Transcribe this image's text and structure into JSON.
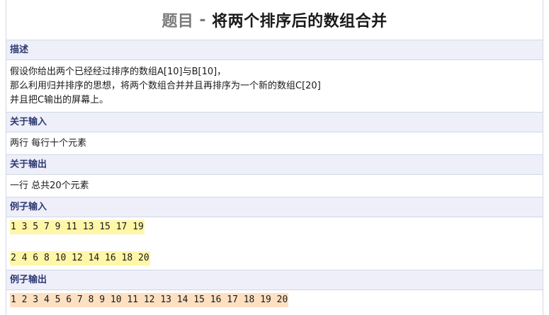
{
  "title": {
    "prefix": "题目",
    "separator": "-",
    "main": "将两个排序后的数组合并"
  },
  "sections": {
    "description": {
      "header": "描述",
      "lines": [
        "假设你给出两个已经经过排序的数组A[10]与B[10]，",
        "那么利用归并排序的思想，将两个数组合并并且再排序为一个新的数组C[20]",
        "并且把C输出的屏幕上。"
      ]
    },
    "input": {
      "header": "关于输入",
      "text": "两行 每行十个元素"
    },
    "output": {
      "header": "关于输出",
      "text": "一行 总共20个元素"
    },
    "sample_input": {
      "header": "例子输入",
      "lines": [
        "1 3 5 7 9 11 13 15 17 19",
        "2 4 6 8 10 12 14 16 18 20"
      ]
    },
    "sample_output": {
      "header": "例子输出",
      "lines": [
        "1 2 3 4 5 6 7 8 9 10 11 12 13 14 15 16 17 18 19 20"
      ]
    }
  },
  "colors": {
    "header_bg": "#efeffa",
    "header_text": "#2e3a73",
    "border": "#cfd8e6",
    "sample_input_highlight": "#fff6a8",
    "sample_output_highlight": "#fde0c2"
  }
}
